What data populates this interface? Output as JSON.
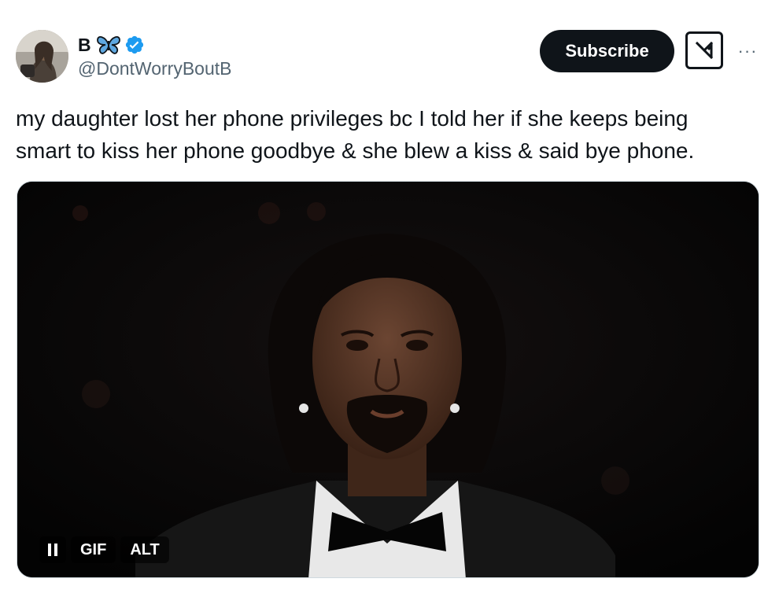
{
  "author": {
    "display_name": "B",
    "handle": "@DontWorryBoutB",
    "badge_icons": [
      "butterfly-emoji-icon",
      "verified-badge-icon"
    ],
    "verified_color": "#1d9bf0"
  },
  "actions": {
    "subscribe_label": "Subscribe",
    "grok_icon": "grok-icon",
    "more_icon": "more-options-icon",
    "more_glyph": "···"
  },
  "tweet": {
    "text": "my daughter lost her phone privileges bc I told her if she keeps being smart to kiss her phone goodbye & she blew a kiss & said bye phone."
  },
  "media": {
    "type": "GIF",
    "controls": {
      "pause_icon": "pause-icon",
      "gif_label": "GIF",
      "alt_label": "ALT"
    }
  },
  "colors": {
    "text": "#0f1419",
    "secondary_text": "#536471",
    "accent": "#1d9bf0",
    "button_bg": "#0f1419"
  }
}
